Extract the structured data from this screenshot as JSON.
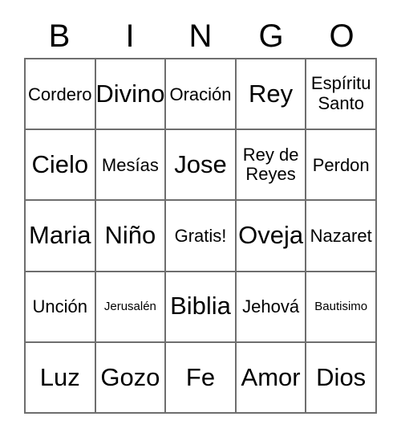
{
  "card": {
    "title_letters": [
      "B",
      "I",
      "N",
      "G",
      "O"
    ],
    "border_color": "#6e6e6e",
    "text_color": "#000000",
    "background_color": "#ffffff",
    "rows": 5,
    "columns": 5,
    "cells": [
      [
        {
          "label": "Cordero",
          "size": "md"
        },
        {
          "label": "Divino",
          "size": "xl"
        },
        {
          "label": "Oración",
          "size": "md"
        },
        {
          "label": "Rey",
          "size": "xl"
        },
        {
          "label": "Espíritu\nSanto",
          "size": "two-line"
        }
      ],
      [
        {
          "label": "Cielo",
          "size": "xl"
        },
        {
          "label": "Mesías",
          "size": "md"
        },
        {
          "label": "Jose",
          "size": "xl"
        },
        {
          "label": "Rey de\nReyes",
          "size": "two-line"
        },
        {
          "label": "Perdon",
          "size": "md"
        }
      ],
      [
        {
          "label": "Maria",
          "size": "xl"
        },
        {
          "label": "Niño",
          "size": "xl"
        },
        {
          "label": "Gratis!",
          "size": "md"
        },
        {
          "label": "Oveja",
          "size": "xl"
        },
        {
          "label": "Nazaret",
          "size": "md"
        }
      ],
      [
        {
          "label": "Unción",
          "size": "md"
        },
        {
          "label": "Jerusalén",
          "size": "xs"
        },
        {
          "label": "Biblia",
          "size": "xl"
        },
        {
          "label": "Jehová",
          "size": "md"
        },
        {
          "label": "Bautisimo",
          "size": "xs"
        }
      ],
      [
        {
          "label": "Luz",
          "size": "xl"
        },
        {
          "label": "Gozo",
          "size": "xl"
        },
        {
          "label": "Fe",
          "size": "xl"
        },
        {
          "label": "Amor",
          "size": "xl"
        },
        {
          "label": "Dios",
          "size": "xl"
        }
      ]
    ]
  }
}
